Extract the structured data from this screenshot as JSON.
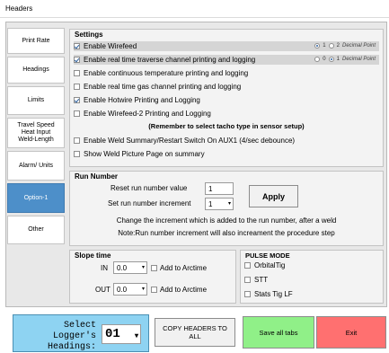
{
  "window": {
    "title": "Headers"
  },
  "tabs": [
    {
      "label": "Print Rate"
    },
    {
      "label": "Headings"
    },
    {
      "label": "Limits"
    },
    {
      "label": "Travel Speed\nHeat Input\nWeld-Length"
    },
    {
      "label": "Alarm/ Units"
    },
    {
      "label": "Option-1"
    },
    {
      "label": "Other"
    }
  ],
  "settings": {
    "title": "Settings",
    "items": [
      {
        "label": "Enable Wirefeed",
        "checked": true
      },
      {
        "label": "Enable real time traverse channel printing and logging",
        "checked": true
      },
      {
        "label": "Enable continuous temperature printing and logging",
        "checked": false
      },
      {
        "label": "Enable real time gas channel printing and logging",
        "checked": false
      },
      {
        "label": "Enable Hotwire Printing and Logging",
        "checked": true
      },
      {
        "label": "Enable Wirefeed-2 Printing and Logging",
        "checked": false
      },
      {
        "label": "Enable Weld Summary/Restart Switch On AUX1  (4/sec debounce)",
        "checked": false
      },
      {
        "label": "Show Weld Picture Page on summary",
        "checked": false
      }
    ],
    "note": "(Remember to select tacho type in sensor setup)",
    "radio1": {
      "opt1": "1",
      "opt2": "2",
      "suffix": "Decimal Point",
      "selected": "1"
    },
    "radio2": {
      "opt1": "0",
      "opt2": "1",
      "suffix": "Decimal Point",
      "selected": "1"
    }
  },
  "run_number": {
    "title": "Run Number",
    "reset_label": "Reset run number value",
    "reset_value": "1",
    "increment_label": "Set run number increment",
    "increment_value": "1",
    "apply_label": "Apply",
    "info1": "Change the increment which is added to the run number, after a weld",
    "info2": "Note:Run number increment will also increament the procedure step"
  },
  "slope": {
    "title": "Slope time",
    "in_label": "IN",
    "in_value": "0.0",
    "out_label": "OUT",
    "out_value": "0.0",
    "add_label": "Add to Arctime"
  },
  "pulse": {
    "title": "PULSE MODE",
    "items": [
      {
        "label": "OrbitalTig"
      },
      {
        "label": "STT"
      },
      {
        "label": "Stats Tig LF"
      }
    ]
  },
  "footer": {
    "logger_label": "Select Logger's Headings:",
    "logger_value": "01",
    "copy_label": "COPY HEADERS TO ALL",
    "save_label": "Save all tabs",
    "exit_label": "Exit"
  },
  "colors": {
    "active_tab": "#4d8fc9",
    "logger_bg": "#8ed3f2",
    "save_bg": "#90f088",
    "exit_bg": "#ff7070"
  }
}
